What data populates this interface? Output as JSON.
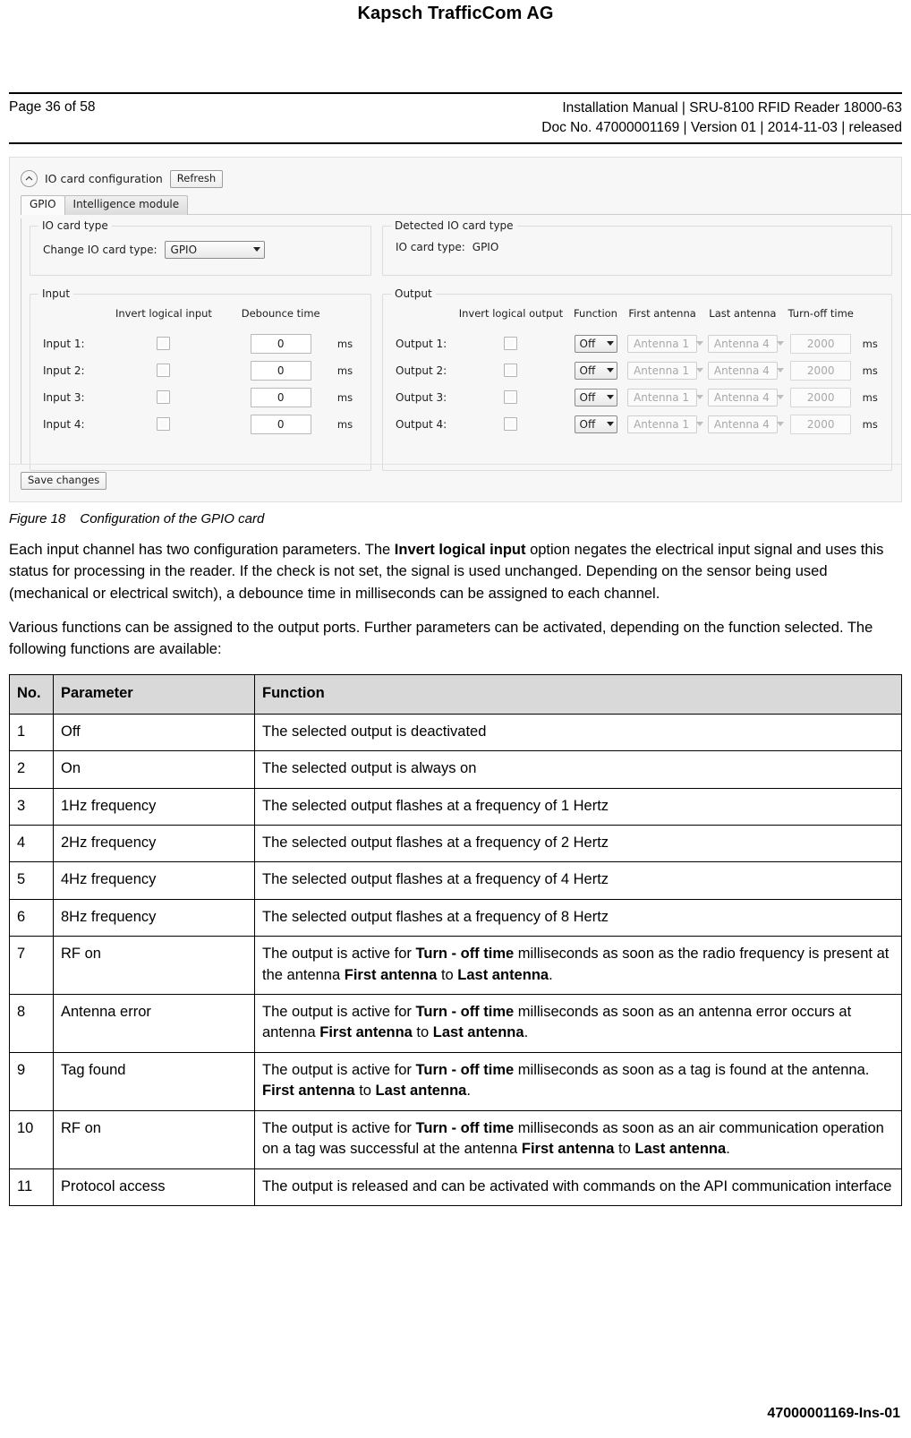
{
  "header": {
    "company": "Kapsch TrafficCom AG",
    "page_label": "Page 36 of 58",
    "manual_line": "Installation Manual | SRU-8100 RFID Reader 18000-63",
    "doc_line": "Doc No. 47000001169 | Version 01 | 2014-11-03 | released"
  },
  "screenshot": {
    "panel_title": "IO card configuration",
    "refresh_label": "Refresh",
    "tabs": [
      {
        "label": "GPIO",
        "active": true
      },
      {
        "label": "Intelligence module",
        "active": false
      }
    ],
    "io_card_type": {
      "legend": "IO card type",
      "change_label": "Change IO card type:",
      "selected": "GPIO"
    },
    "detected_io_card_type": {
      "legend": "Detected IO card type",
      "label": "IO card type:",
      "value": "GPIO"
    },
    "input": {
      "legend": "Input",
      "columns": [
        "Invert logical input",
        "Debounce time"
      ],
      "unit": "ms",
      "rows": [
        {
          "label": "Input 1:",
          "invert": false,
          "debounce": "0"
        },
        {
          "label": "Input 2:",
          "invert": false,
          "debounce": "0"
        },
        {
          "label": "Input 3:",
          "invert": false,
          "debounce": "0"
        },
        {
          "label": "Input 4:",
          "invert": false,
          "debounce": "0"
        }
      ]
    },
    "output": {
      "legend": "Output",
      "columns": [
        "Invert logical output",
        "Function",
        "First antenna",
        "Last antenna",
        "Turn-off time"
      ],
      "unit": "ms",
      "rows": [
        {
          "label": "Output 1:",
          "invert": false,
          "function": "Off",
          "first_antenna": "Antenna 1",
          "last_antenna": "Antenna 4",
          "turn_off_time": "2000"
        },
        {
          "label": "Output 2:",
          "invert": false,
          "function": "Off",
          "first_antenna": "Antenna 1",
          "last_antenna": "Antenna 4",
          "turn_off_time": "2000"
        },
        {
          "label": "Output 3:",
          "invert": false,
          "function": "Off",
          "first_antenna": "Antenna 1",
          "last_antenna": "Antenna 4",
          "turn_off_time": "2000"
        },
        {
          "label": "Output 4:",
          "invert": false,
          "function": "Off",
          "first_antenna": "Antenna 1",
          "last_antenna": "Antenna 4",
          "turn_off_time": "2000"
        }
      ]
    },
    "save_label": "Save changes"
  },
  "figure": {
    "number": "Figure 18",
    "caption": "Configuration of the GPIO card"
  },
  "paragraphs": [
    "Each input channel has two configuration parameters. The <b>Invert logical input</b> option negates the electrical input signal and uses this status for processing in the reader. If the check is not set, the signal is used unchanged. Depending on the sensor being used (mechanical or electrical switch), a debounce time in milliseconds can be assigned to each channel.",
    "Various functions can be assigned to the output ports. Further parameters can be activated, depending on the function selected. The following functions are available:"
  ],
  "table": {
    "headers": [
      "No.",
      "Parameter",
      "Function"
    ],
    "rows": [
      {
        "no": "1",
        "parameter": "Off",
        "function": "The selected output is deactivated"
      },
      {
        "no": "2",
        "parameter": "On",
        "function": "The selected output is always on"
      },
      {
        "no": "3",
        "parameter": "1Hz frequency",
        "function": "The selected output flashes at a frequency of 1 Hertz"
      },
      {
        "no": "4",
        "parameter": "2Hz frequency",
        "function": "The selected output flashes at a frequency of 2 Hertz"
      },
      {
        "no": "5",
        "parameter": "4Hz frequency",
        "function": "The selected output flashes at a frequency of 4 Hertz"
      },
      {
        "no": "6",
        "parameter": "8Hz frequency",
        "function": "The selected output flashes at a frequency of 8 Hertz"
      },
      {
        "no": "7",
        "parameter": "RF on",
        "function": "The output is active for <b>Turn - off time</b> milliseconds as soon as the radio frequency is present at the antenna <b>First antenna</b> to <b>Last antenna</b>."
      },
      {
        "no": "8",
        "parameter": "Antenna error",
        "function": "The output is active for <b>Turn - off time</b> milliseconds as soon as an antenna error occurs at antenna <b>First antenna</b> to <b>Last antenna</b>."
      },
      {
        "no": "9",
        "parameter": "Tag found",
        "function": "The output is active for <b>Turn - off time</b> milliseconds as soon as a tag is found at the antenna. <b>First antenna</b> to <b>Last antenna</b>."
      },
      {
        "no": "10",
        "parameter": "RF on",
        "function": "The output is active for <b>Turn - off time</b> milliseconds as soon as an air communication operation on a tag was successful at the antenna <b>First antenna</b> to <b>Last antenna</b>."
      },
      {
        "no": "11",
        "parameter": "Protocol access",
        "function": "The output is released and can be activated with commands on the API communication interface"
      }
    ]
  },
  "footer": {
    "doc_code": "47000001169-Ins-01"
  }
}
